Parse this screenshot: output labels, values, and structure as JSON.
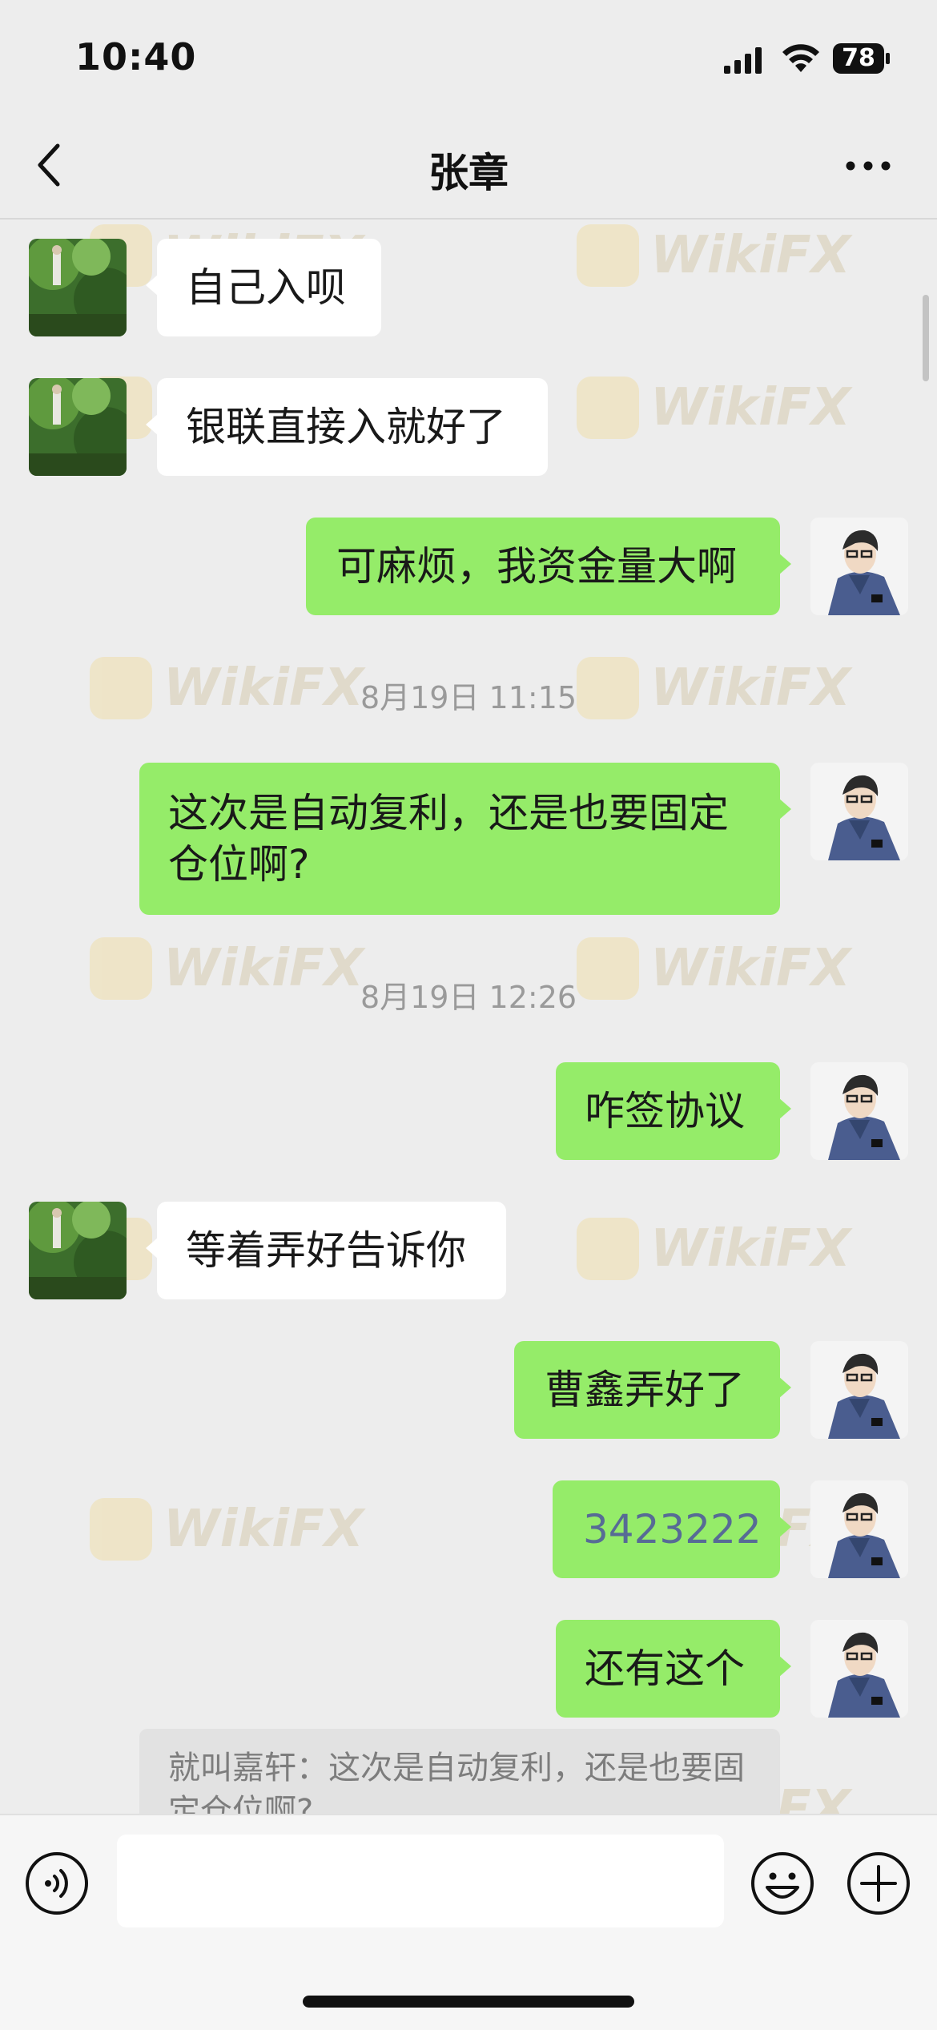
{
  "status_bar": {
    "time": "10:40",
    "battery": "78"
  },
  "header": {
    "title": "张章"
  },
  "messages": [
    {
      "side": "left",
      "text": "自己入呗"
    },
    {
      "side": "left",
      "text": "银联直接入就好了"
    },
    {
      "side": "right",
      "text": "可麻烦，我资金量大啊"
    },
    {
      "side": "right",
      "text": "这次是自动复利，还是也要固定仓位啊?"
    },
    {
      "side": "right",
      "text": "咋签协议"
    },
    {
      "side": "left",
      "text": "等着弄好告诉你"
    },
    {
      "side": "right",
      "text": "曹鑫弄好了"
    },
    {
      "side": "right",
      "text": "3423222"
    },
    {
      "side": "right",
      "text": "还有这个"
    }
  ],
  "timestamps": [
    "8月19日 11:15",
    "8月19日 12:26"
  ],
  "quote": {
    "text": "就叫嘉轩：这次是自动复利，还是也要固定仓位啊?"
  },
  "watermark": "WikiFX",
  "input": {
    "value": "",
    "placeholder": ""
  },
  "colors": {
    "sent_bubble": "#95ec69",
    "received_bubble": "#ffffff",
    "background": "#ededed",
    "link_text": "#576b95"
  }
}
